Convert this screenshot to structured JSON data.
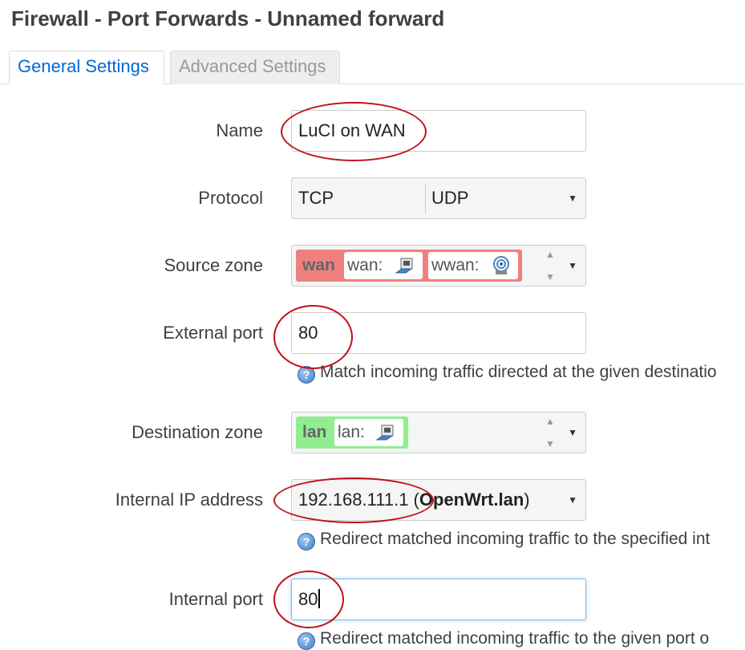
{
  "page": {
    "title": "Firewall - Port Forwards - Unnamed forward"
  },
  "tabs": [
    {
      "label": "General Settings",
      "active": true
    },
    {
      "label": "Advanced Settings",
      "active": false
    }
  ],
  "form": {
    "name": {
      "label": "Name",
      "value": "LuCI on WAN"
    },
    "protocol": {
      "label": "Protocol",
      "values": [
        "TCP",
        "UDP"
      ]
    },
    "source_zone": {
      "label": "Source zone",
      "zone": "wan",
      "color": "#f08080",
      "networks": [
        {
          "label": "wan:",
          "icon": "ethernet-port-icon"
        },
        {
          "label": "wwan:",
          "icon": "wireless-icon"
        }
      ]
    },
    "external_port": {
      "label": "External port",
      "value": "80",
      "help": "Match incoming traffic directed at the given destinatio"
    },
    "dest_zone": {
      "label": "Destination zone",
      "zone": "lan",
      "color": "#90ee90",
      "networks": [
        {
          "label": "lan:",
          "icon": "ethernet-port-icon"
        }
      ]
    },
    "internal_ip": {
      "label": "Internal IP address",
      "value_ip": "192.168.111.1",
      "value_open": " (",
      "value_host": "OpenWrt.lan",
      "value_close": ")",
      "help": "Redirect matched incoming traffic to the specified int"
    },
    "internal_port": {
      "label": "Internal port",
      "value": "80",
      "help": "Redirect matched incoming traffic to the given port o"
    }
  },
  "annotation_color": "#c0101a"
}
